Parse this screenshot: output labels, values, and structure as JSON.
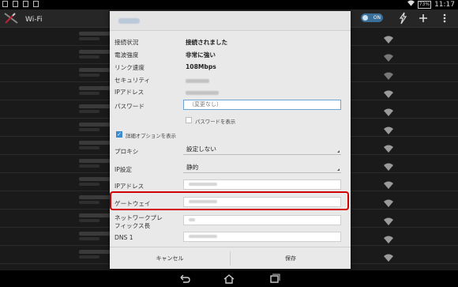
{
  "status_bar": {
    "battery": "73%",
    "time": "11:17"
  },
  "app_bar": {
    "title": "Wi-Fi",
    "toggle_label": "ON"
  },
  "dialog": {
    "info": [
      {
        "label": "接続状況",
        "value": "接続されました"
      },
      {
        "label": "電波強度",
        "value": "非常に強い"
      },
      {
        "label": "リンク速度",
        "value": "108Mbps"
      },
      {
        "label": "セキュリティ"
      },
      {
        "label": "IPアドレス"
      }
    ],
    "password": {
      "label": "パスワード",
      "placeholder": "（変更なし）",
      "show_label": "パスワードを表示"
    },
    "advanced_label": "詳細オプションを表示",
    "proxy": {
      "label": "プロキシ",
      "value": "設定しない"
    },
    "ip_settings": {
      "label": "IP設定",
      "value": "静的"
    },
    "ip_address_label": "IPアドレス",
    "gateway_label": "ゲートウェイ",
    "prefix_label_1": "ネットワークプレ",
    "prefix_label_2": "フィックス長",
    "dns1_label": "DNS 1",
    "cancel_label": "キャンセル",
    "save_label": "保存"
  },
  "colors": {
    "highlight": "#d20000",
    "accent": "#3c8ad0"
  }
}
